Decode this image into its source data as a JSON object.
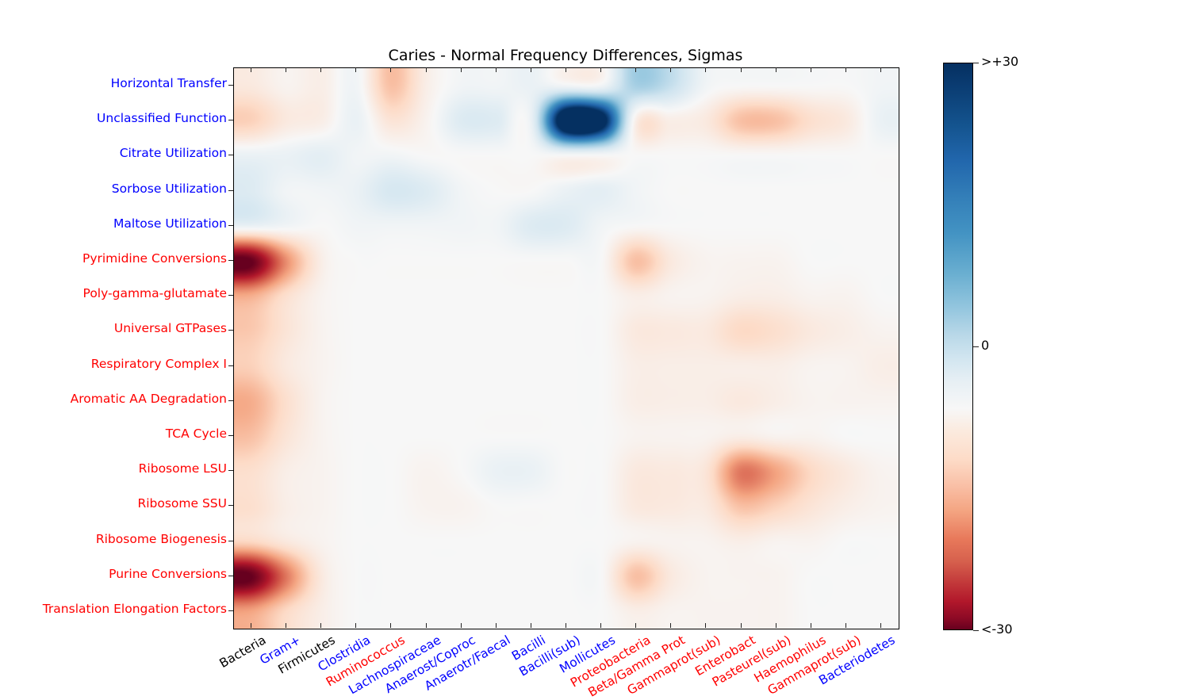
{
  "chart_data": {
    "type": "heatmap",
    "title": "Caries - Normal Frequency Differences, Sigmas",
    "xlabel": "",
    "ylabel": "",
    "colormap": "RdBu",
    "colorbar": {
      "ticks": [
        ">+30",
        "0",
        "<-30"
      ],
      "tick_positions": [
        30,
        0,
        -30
      ],
      "vmin": -30,
      "vmax": 30,
      "top_color": "#053061",
      "mid_color": "#f7f7f7",
      "bottom_color": "#67001f"
    },
    "grid": false,
    "legend": "colorbar-right",
    "x_categories": [
      {
        "label": "Bacteria",
        "color": "#000000"
      },
      {
        "label": "Gram+",
        "color": "#0000ff"
      },
      {
        "label": "Firmicutes",
        "color": "#000000"
      },
      {
        "label": "Clostridia",
        "color": "#0000ff"
      },
      {
        "label": "Ruminococcus",
        "color": "#ff0000"
      },
      {
        "label": "Lachnospiraceae",
        "color": "#0000ff"
      },
      {
        "label": "Anaerost/Coproc",
        "color": "#0000ff"
      },
      {
        "label": "Anaerotr/Faecal",
        "color": "#0000ff"
      },
      {
        "label": "Bacilli",
        "color": "#0000ff"
      },
      {
        "label": "Bacilli(sub)",
        "color": "#0000ff"
      },
      {
        "label": "Mollicutes",
        "color": "#0000ff"
      },
      {
        "label": "Proteobacteria",
        "color": "#ff0000"
      },
      {
        "label": "Beta/Gamma Prot",
        "color": "#ff0000"
      },
      {
        "label": "Gammaprot(sub)",
        "color": "#ff0000"
      },
      {
        "label": "Enterobact",
        "color": "#ff0000"
      },
      {
        "label": "Pasteurel(sub)",
        "color": "#ff0000"
      },
      {
        "label": "Haemophilus",
        "color": "#ff0000"
      },
      {
        "label": "Gammaprot(sub)",
        "color": "#ff0000"
      },
      {
        "label": "Bacteriodetes",
        "color": "#0000ff"
      }
    ],
    "y_categories": [
      {
        "label": "Horizontal Transfer",
        "color": "#0000ff"
      },
      {
        "label": "Unclassified Function",
        "color": "#0000ff"
      },
      {
        "label": "Citrate Utilization",
        "color": "#0000ff"
      },
      {
        "label": "Sorbose Utilization",
        "color": "#0000ff"
      },
      {
        "label": "Maltose Utilization",
        "color": "#0000ff"
      },
      {
        "label": "Pyrimidine Conversions",
        "color": "#ff0000"
      },
      {
        "label": "Poly-gamma-glutamate",
        "color": "#ff0000"
      },
      {
        "label": "Universal GTPases",
        "color": "#ff0000"
      },
      {
        "label": "Respiratory Complex I",
        "color": "#ff0000"
      },
      {
        "label": "Aromatic AA Degradation",
        "color": "#ff0000"
      },
      {
        "label": "TCA Cycle",
        "color": "#ff0000"
      },
      {
        "label": "Ribosome LSU",
        "color": "#ff0000"
      },
      {
        "label": "Ribosome SSU",
        "color": "#ff0000"
      },
      {
        "label": "Ribosome Biogenesis",
        "color": "#ff0000"
      },
      {
        "label": "Purine Conversions",
        "color": "#ff0000"
      },
      {
        "label": "Translation Elongation Factors",
        "color": "#ff0000"
      }
    ],
    "values": [
      [
        -3,
        -1,
        -2,
        1,
        -9,
        -2,
        1,
        1,
        2,
        1,
        1,
        10,
        7,
        1,
        0,
        0,
        0,
        0,
        1
      ],
      [
        -7,
        -3,
        -2,
        2,
        -4,
        -1,
        4,
        4,
        2,
        38,
        34,
        -2,
        -2,
        -3,
        -9,
        -9,
        -5,
        -3,
        2
      ],
      [
        2,
        2,
        3,
        1,
        1,
        0,
        0,
        0,
        0,
        0,
        0,
        0,
        0,
        0,
        0,
        0,
        0,
        0,
        0
      ],
      [
        4,
        1,
        1,
        2,
        5,
        4,
        1,
        0,
        0,
        2,
        3,
        1,
        0,
        0,
        0,
        0,
        0,
        0,
        0
      ],
      [
        2,
        1,
        0,
        1,
        1,
        1,
        1,
        1,
        4,
        4,
        1,
        0,
        0,
        0,
        0,
        0,
        0,
        0,
        0
      ],
      [
        -30,
        -14,
        -2,
        0,
        0,
        0,
        0,
        0,
        0,
        0,
        0,
        -9,
        -3,
        -1,
        -1,
        -1,
        0,
        0,
        0
      ],
      [
        -11,
        -5,
        -1,
        0,
        0,
        0,
        0,
        0,
        0,
        0,
        0,
        -2,
        -1,
        -1,
        -2,
        -2,
        -1,
        -1,
        0
      ],
      [
        -8,
        -4,
        -1,
        0,
        0,
        0,
        0,
        0,
        0,
        0,
        0,
        -3,
        -3,
        -3,
        -6,
        -5,
        -3,
        -2,
        -1
      ],
      [
        -7,
        -3,
        -1,
        0,
        0,
        0,
        0,
        0,
        0,
        0,
        0,
        -2,
        -2,
        -2,
        -2,
        -2,
        -1,
        -1,
        -2
      ],
      [
        -11,
        -5,
        -1,
        0,
        0,
        0,
        0,
        0,
        0,
        0,
        0,
        -2,
        -2,
        -2,
        -3,
        -2,
        -1,
        -1,
        -1
      ],
      [
        -9,
        -4,
        -1,
        0,
        0,
        0,
        0,
        0,
        0,
        0,
        0,
        -1,
        -1,
        -1,
        -2,
        -1,
        -1,
        0,
        0
      ],
      [
        -5,
        -2,
        -1,
        0,
        0,
        -1,
        0,
        2,
        2,
        0,
        0,
        -3,
        -3,
        -4,
        -16,
        -12,
        -6,
        -3,
        -1
      ],
      [
        -5,
        -2,
        -1,
        0,
        0,
        -1,
        -1,
        0,
        0,
        0,
        0,
        -3,
        -3,
        -3,
        -9,
        -7,
        -4,
        -2,
        -1
      ],
      [
        -6,
        -3,
        -1,
        0,
        0,
        0,
        0,
        0,
        0,
        0,
        0,
        -1,
        -1,
        -1,
        -2,
        -1,
        -1,
        0,
        0
      ],
      [
        -30,
        -16,
        -3,
        0,
        0,
        0,
        0,
        0,
        0,
        0,
        0,
        -9,
        -3,
        -1,
        -1,
        -1,
        0,
        0,
        0
      ],
      [
        -12,
        -6,
        -2,
        0,
        0,
        0,
        0,
        0,
        0,
        0,
        0,
        -2,
        -1,
        -1,
        -1,
        -1,
        0,
        0,
        0
      ]
    ],
    "notes": "Values are in sigmas (standard deviations). Blue = positive (enriched in caries), Red = negative. Rendered with smooth bilinear interpolation."
  }
}
